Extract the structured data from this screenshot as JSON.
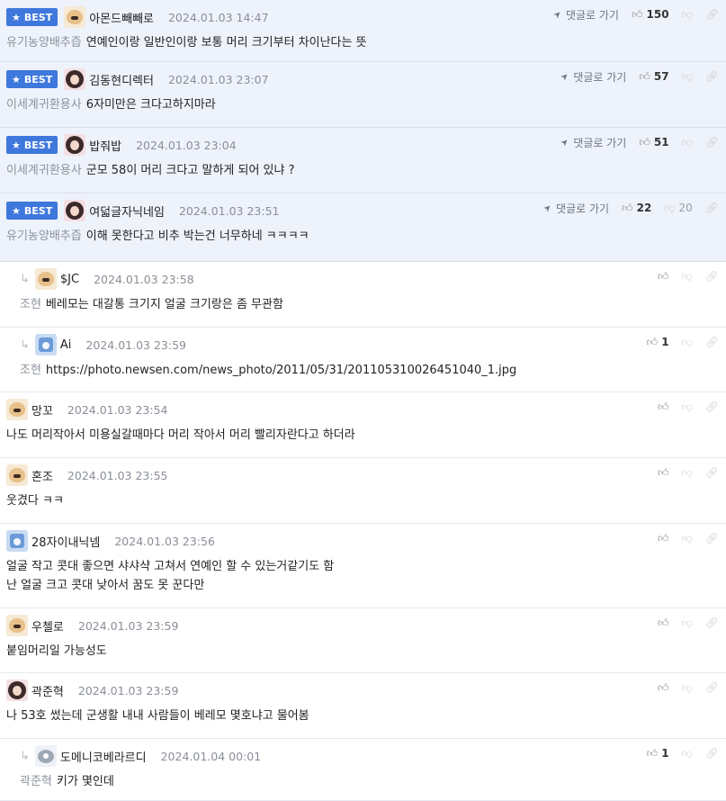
{
  "labels": {
    "best": "BEST",
    "goto_comment": "댓글로 가기"
  },
  "icons": {
    "star": "star-icon",
    "location_arrow": "location-arrow-icon",
    "thumbs_up": "thumbs-up-icon",
    "thumbs_down": "thumbs-down-icon",
    "link": "link-icon",
    "reply_arrow": "reply-arrow-icon"
  },
  "colors": {
    "best_badge": "#3f78dc",
    "best_row_bg": "#eef2fb",
    "muted_text": "#8d939c"
  },
  "comments": [
    {
      "best": true,
      "reply": false,
      "avatar": "dog",
      "nick": "아몬드빼빼로",
      "date": "2024.01.03 14:47",
      "category": "유기농양배추즙",
      "text": "연예인이랑 일반인이랑 보통 머리 크기부터 차이난다는 뜻",
      "likes": "150",
      "dislikes": ""
    },
    {
      "best": true,
      "reply": false,
      "avatar": "girl",
      "nick": "김동현디렉터",
      "date": "2024.01.03 23:07",
      "category": "이세계귀환용사",
      "text": "6자미만은 크다고하지마라",
      "likes": "57",
      "dislikes": ""
    },
    {
      "best": true,
      "reply": false,
      "avatar": "girl",
      "nick": "밥줘밥",
      "date": "2024.01.03 23:04",
      "category": "이세계귀환용사",
      "text": "군모 58이 머리 크다고 말하게 되어 있냐 ?",
      "likes": "51",
      "dislikes": ""
    },
    {
      "best": true,
      "reply": false,
      "avatar": "girl",
      "nick": "여덟글자닉네임",
      "date": "2024.01.03 23:51",
      "category": "유기농양배추즙",
      "text": "이해 못한다고 비추 박는건 너무하네 ㅋㅋㅋㅋ",
      "likes": "22",
      "dislikes": "20"
    },
    {
      "best": false,
      "reply": true,
      "avatar": "dog",
      "nick": "$JC",
      "date": "2024.01.03 23:58",
      "category": "조현",
      "text": "베레모는 대갈통 크기지 얼굴 크기랑은 좀 무관함",
      "likes": "",
      "dislikes": ""
    },
    {
      "best": false,
      "reply": true,
      "avatar": "blue",
      "nick": "Ai",
      "date": "2024.01.03 23:59",
      "category": "조현",
      "text": "https://photo.newsen.com/news_photo/2011/05/31/201105310026451040_1.jpg",
      "likes": "1",
      "dislikes": ""
    },
    {
      "best": false,
      "reply": false,
      "avatar": "dog",
      "nick": "망꼬",
      "date": "2024.01.03 23:54",
      "category": "",
      "text": "나도 머리작아서 미용실갈때마다 머리 작아서 머리 빨리자란다고 하더라",
      "likes": "",
      "dislikes": ""
    },
    {
      "best": false,
      "reply": false,
      "avatar": "dog",
      "nick": "혼조",
      "date": "2024.01.03 23:55",
      "category": "",
      "text": "웃겼다 ㅋㅋ",
      "likes": "",
      "dislikes": ""
    },
    {
      "best": false,
      "reply": false,
      "avatar": "blue",
      "nick": "28자이내닉넴",
      "date": "2024.01.03 23:56",
      "category": "",
      "text": "얼굴 작고 콧대 좋으면 샤샤샥 고쳐서 연예인 할 수 있는거같기도 함",
      "text2": "난 얼굴 크고 콧대 낮아서 꿈도 못 꾼다만",
      "likes": "",
      "dislikes": ""
    },
    {
      "best": false,
      "reply": false,
      "avatar": "dog",
      "nick": "우첼로",
      "date": "2024.01.03 23:59",
      "category": "",
      "text": "붙임머리일 가능성도",
      "likes": "",
      "dislikes": ""
    },
    {
      "best": false,
      "reply": false,
      "avatar": "girl",
      "nick": "곽준혁",
      "date": "2024.01.03 23:59",
      "category": "",
      "text": "나 53호 썼는데 군생활 내내 사람들이 베레모 몇호냐고 물어봄",
      "likes": "",
      "dislikes": ""
    },
    {
      "best": false,
      "reply": true,
      "avatar": "bird",
      "nick": "도메니코베라르디",
      "date": "2024.01.04 00:01",
      "category": "곽준혁",
      "text": "키가 몇인데",
      "likes": "1",
      "dislikes": ""
    }
  ]
}
